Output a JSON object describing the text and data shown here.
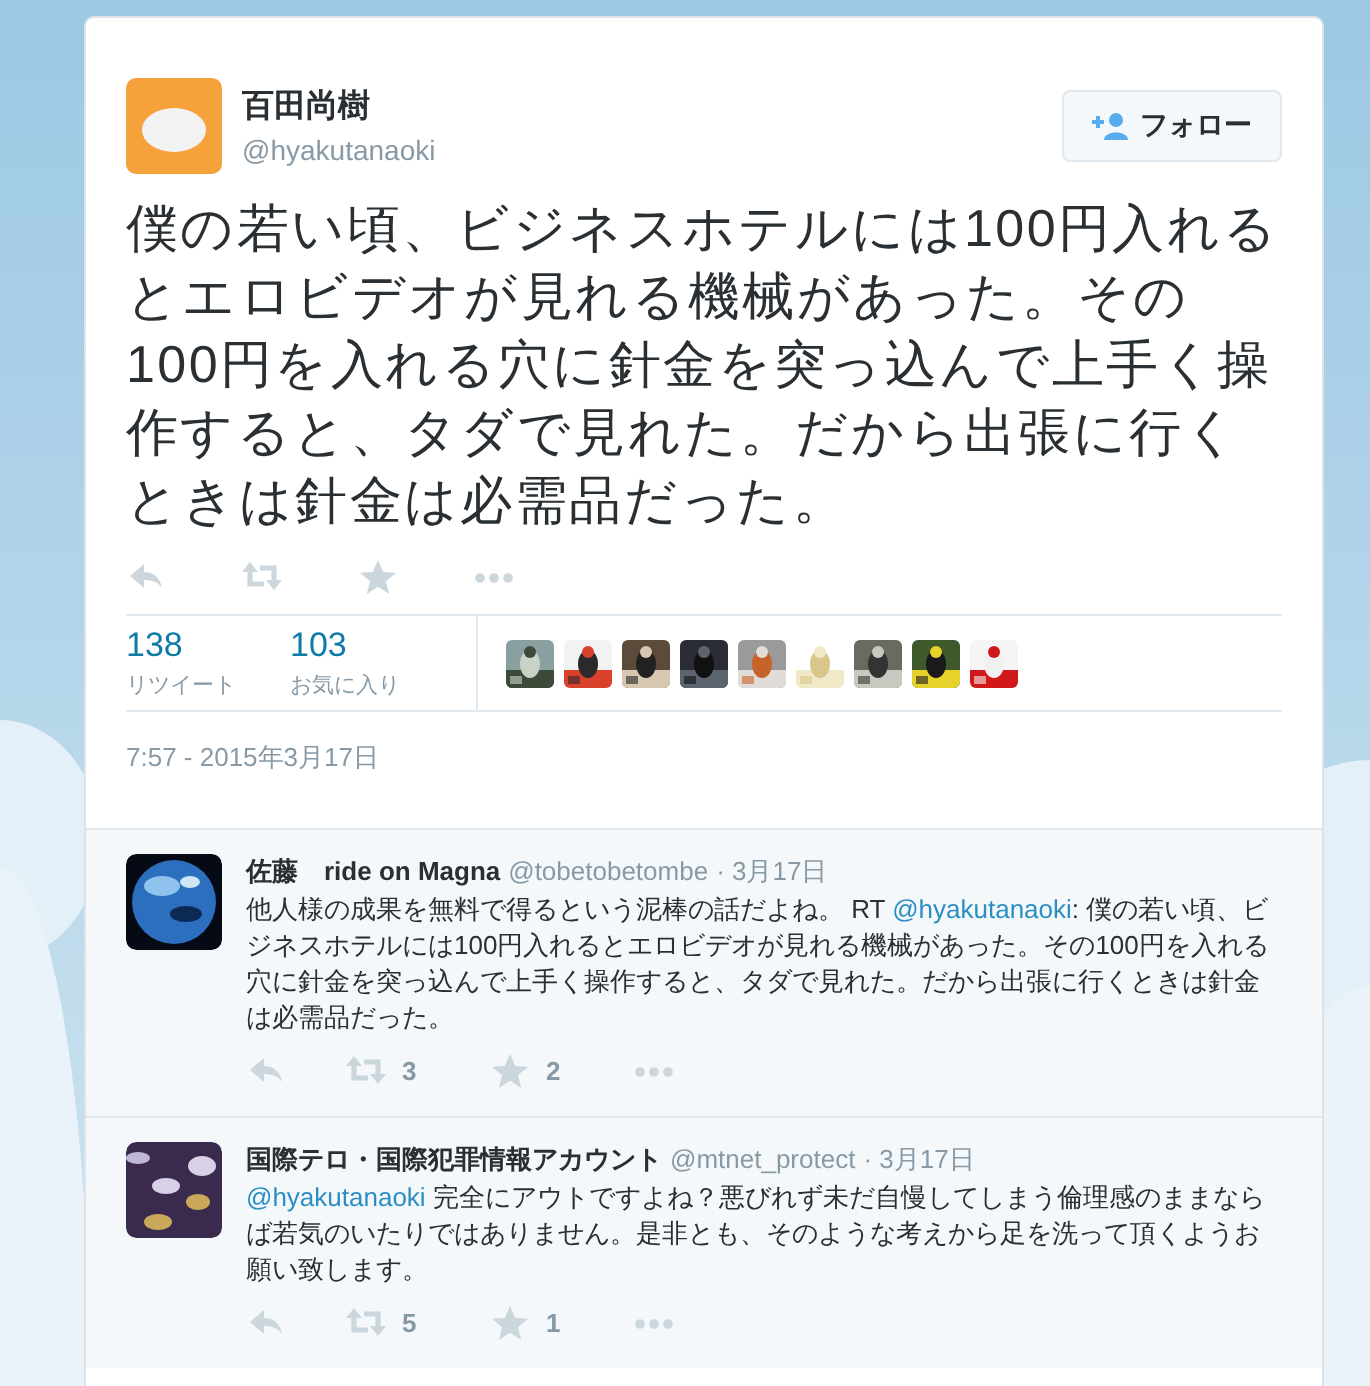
{
  "tweet": {
    "name": "百田尚樹",
    "handle": "@hyakutanaoki",
    "follow_button": "フォロー",
    "text": "僕の若い頃、ビジネスホテルには100円入れるとエロビデオが見れる機械があった。その100円を入れる穴に針金を突っ込んで上手く操作すると、タダで見れた。だから出張に行くときは針金は必需品だった。",
    "stats": [
      {
        "count": "138",
        "label": "リツイート"
      },
      {
        "count": "103",
        "label": "お気に入り"
      }
    ],
    "timestamp": "7:57 - 2015年3月17日"
  },
  "replies": [
    {
      "name": "佐藤　ride on Magna",
      "handle": "@tobetobetombe",
      "date": "· 3月17日",
      "text_parts": [
        {
          "kind": "text",
          "text": "他人様の成果を無料で得るという泥棒の話だよね。 RT "
        },
        {
          "kind": "link",
          "text": "@hyakutanaoki"
        },
        {
          "kind": "text",
          "text": ": 僕の若い頃、ビジネスホテルには100円入れるとエロビデオが見れる機械があった。その100円を入れる穴に針金を突っ込んで上手く操作すると、タダで見れた。だから出張に行くときは針金は必需品だった。"
        }
      ],
      "retweets": "3",
      "favorites": "2"
    },
    {
      "name": "国際テロ・国際犯罪情報アカウント",
      "handle": "@mtnet_protect",
      "date": "· 3月17日",
      "text_parts": [
        {
          "kind": "link",
          "text": "@hyakutanaoki"
        },
        {
          "kind": "text",
          "text": " 完全にアウトですよね？悪びれず未だ自慢してしまう倫理感のままならば若気のいたりではありません。是非とも、そのような考えから足を洗って頂くようお願い致します。"
        }
      ],
      "retweets": "5",
      "favorites": "1"
    }
  ]
}
